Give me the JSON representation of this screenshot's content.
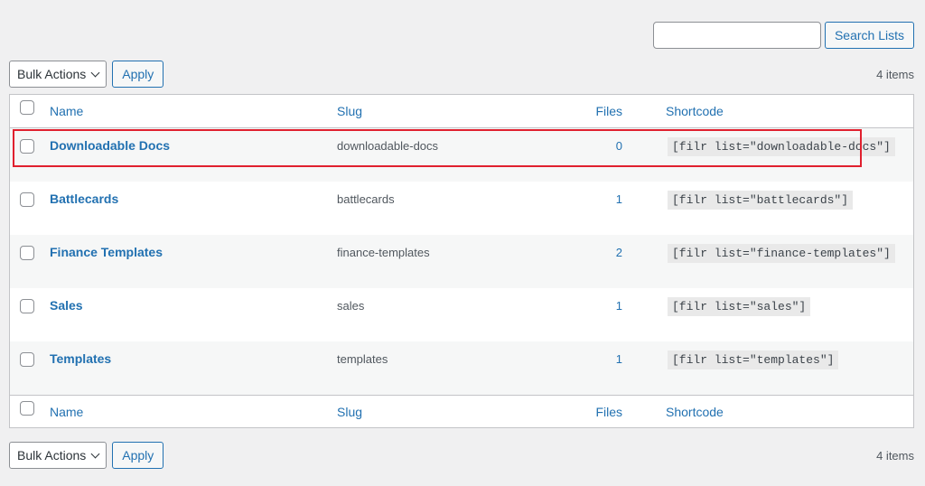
{
  "search": {
    "placeholder": "",
    "value": "",
    "button_label": "Search Lists"
  },
  "tablenav_top": {
    "bulk_actions_label": "Bulk Actions",
    "apply_label": "Apply",
    "item_count": "4 items"
  },
  "tablenav_bottom": {
    "bulk_actions_label": "Bulk Actions",
    "apply_label": "Apply",
    "item_count": "4 items"
  },
  "table": {
    "columns": {
      "name": "Name",
      "slug": "Slug",
      "files": "Files",
      "shortcode": "Shortcode"
    },
    "rows": [
      {
        "name": "Downloadable Docs",
        "slug": "downloadable-docs",
        "files": "0",
        "shortcode": "[filr list=\"downloadable-docs\"]"
      },
      {
        "name": "Battlecards",
        "slug": "battlecards",
        "files": "1",
        "shortcode": "[filr list=\"battlecards\"]"
      },
      {
        "name": "Finance Templates",
        "slug": "finance-templates",
        "files": "2",
        "shortcode": "[filr list=\"finance-templates\"]"
      },
      {
        "name": "Sales",
        "slug": "sales",
        "files": "1",
        "shortcode": "[filr list=\"sales\"]"
      },
      {
        "name": "Templates",
        "slug": "templates",
        "files": "1",
        "shortcode": "[filr list=\"templates\"]"
      }
    ]
  },
  "highlight": {
    "row_index": 0,
    "color": "#e0202e"
  },
  "colors": {
    "link": "#2271b1",
    "background": "#f0f0f1"
  }
}
